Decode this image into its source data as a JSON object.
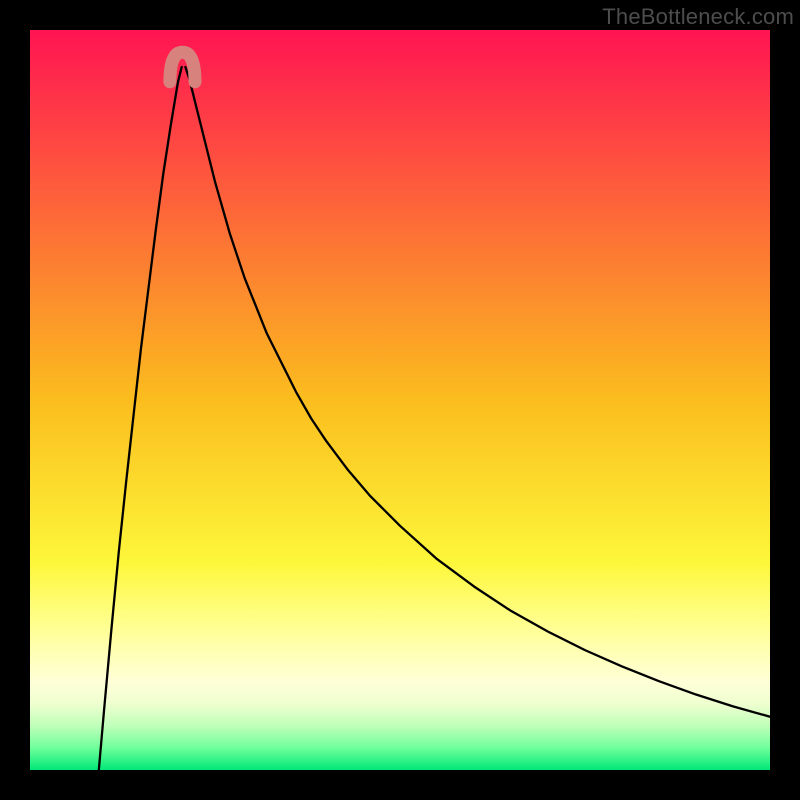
{
  "watermark": "TheBottleneck.com",
  "chart_data": {
    "type": "line",
    "title": "",
    "xlabel": "",
    "ylabel": "",
    "xlim": [
      0,
      100
    ],
    "ylim": [
      0,
      100
    ],
    "grid": false,
    "legend": false,
    "background_gradient": {
      "stops": [
        {
          "pos": 0.0,
          "color": "#ff1452"
        },
        {
          "pos": 0.5,
          "color": "#fbbd1e"
        },
        {
          "pos": 0.72,
          "color": "#fdf73a"
        },
        {
          "pos": 0.8,
          "color": "#ffff8c"
        },
        {
          "pos": 0.84,
          "color": "#ffffb4"
        },
        {
          "pos": 0.88,
          "color": "#ffffd7"
        },
        {
          "pos": 0.91,
          "color": "#efffd0"
        },
        {
          "pos": 0.94,
          "color": "#c0ffba"
        },
        {
          "pos": 0.97,
          "color": "#70ff9a"
        },
        {
          "pos": 1.0,
          "color": "#00e878"
        }
      ]
    },
    "annotations": [
      {
        "type": "pink-band",
        "color": "#d8827e",
        "x_range": [
          18.9,
          22.3
        ],
        "y_range": [
          93,
          97
        ]
      }
    ],
    "series": [
      {
        "name": "left-branch",
        "x": [
          9.3,
          10,
          11,
          12,
          13,
          14,
          15,
          16,
          17,
          18,
          19,
          19.5,
          20,
          20.5
        ],
        "y": [
          0,
          8,
          19,
          29.5,
          39,
          48,
          57,
          65,
          73,
          80.5,
          87,
          90,
          93,
          95
        ]
      },
      {
        "name": "right-branch",
        "x": [
          21,
          21.5,
          22,
          23,
          24,
          25,
          26,
          27,
          28,
          29,
          30,
          32,
          34,
          36,
          38,
          40,
          43,
          46,
          50,
          55,
          60,
          65,
          70,
          75,
          80,
          85,
          90,
          95,
          100
        ],
        "y": [
          95,
          93.5,
          91.5,
          87.5,
          83.5,
          79.5,
          76,
          72.5,
          69.5,
          66.5,
          64,
          59,
          55,
          51,
          47.5,
          44.5,
          40.5,
          37,
          33,
          28.5,
          24.8,
          21.5,
          18.7,
          16.2,
          14,
          12,
          10.2,
          8.6,
          7.2
        ]
      }
    ]
  }
}
